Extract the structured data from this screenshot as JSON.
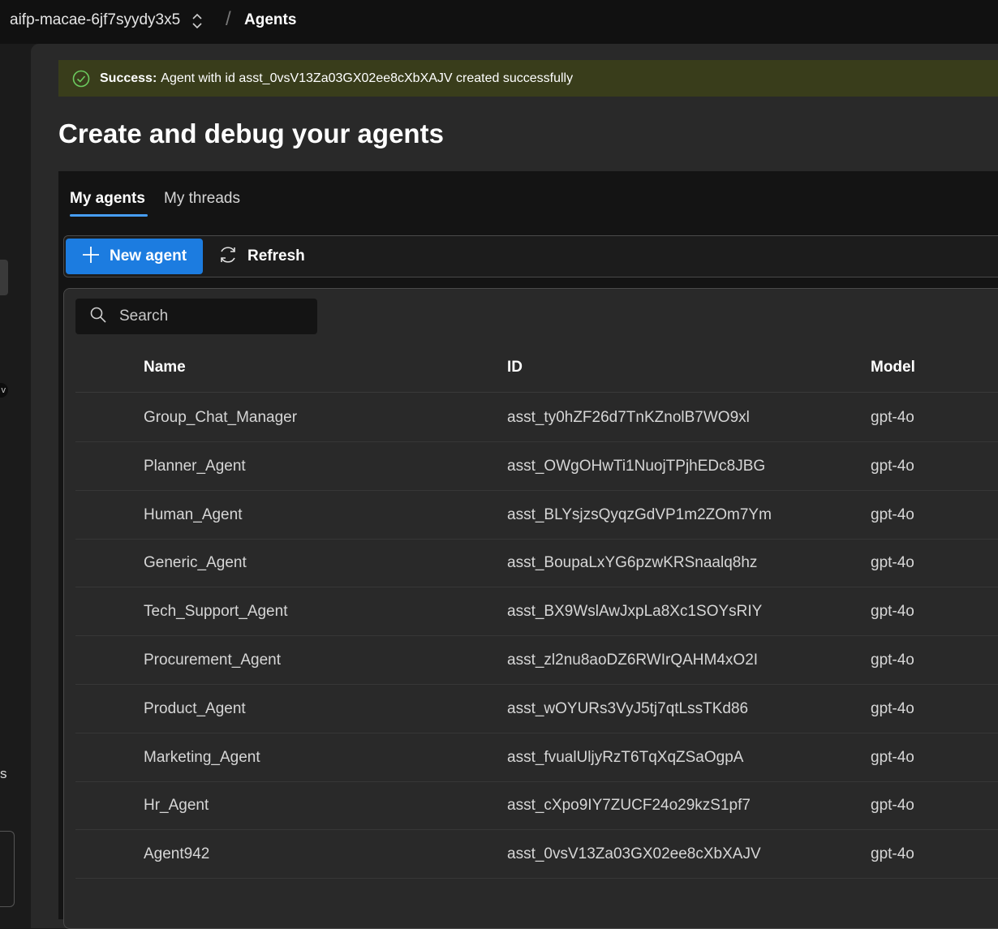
{
  "topbar": {
    "project_name": "aifp-macae-6jf7syydy3x5",
    "breadcrumb_separator": "/",
    "breadcrumb_current": "Agents"
  },
  "leftrail": {
    "badge_text": "v",
    "letter": "s"
  },
  "banner": {
    "status_label": "Success:",
    "message": "Agent with id asst_0vsV13Za03GX02ee8cXbXAJV created successfully",
    "color": "#393d1b",
    "icon": "check-circle-icon"
  },
  "page": {
    "title": "Create and debug your agents"
  },
  "tabs": [
    {
      "label": "My agents",
      "active": true
    },
    {
      "label": "My threads",
      "active": false
    }
  ],
  "toolbar": {
    "new_agent_label": "New agent",
    "refresh_label": "Refresh",
    "accent_color": "#1c7ce0"
  },
  "search": {
    "placeholder": "Search",
    "value": ""
  },
  "table": {
    "columns": [
      "Name",
      "ID",
      "Model"
    ],
    "rows": [
      {
        "name": "Group_Chat_Manager",
        "id": "asst_ty0hZF26d7TnKZnolB7WO9xl",
        "model": "gpt-4o"
      },
      {
        "name": "Planner_Agent",
        "id": "asst_OWgOHwTi1NuojTPjhEDc8JBG",
        "model": "gpt-4o"
      },
      {
        "name": "Human_Agent",
        "id": "asst_BLYsjzsQyqzGdVP1m2ZOm7Ym",
        "model": "gpt-4o"
      },
      {
        "name": "Generic_Agent",
        "id": "asst_BoupaLxYG6pzwKRSnaalq8hz",
        "model": "gpt-4o"
      },
      {
        "name": "Tech_Support_Agent",
        "id": "asst_BX9WslAwJxpLa8Xc1SOYsRIY",
        "model": "gpt-4o"
      },
      {
        "name": "Procurement_Agent",
        "id": "asst_zl2nu8aoDZ6RWIrQAHM4xO2I",
        "model": "gpt-4o"
      },
      {
        "name": "Product_Agent",
        "id": "asst_wOYURs3VyJ5tj7qtLssTKd86",
        "model": "gpt-4o"
      },
      {
        "name": "Marketing_Agent",
        "id": "asst_fvualUljyRzT6TqXqZSaOgpA",
        "model": "gpt-4o"
      },
      {
        "name": "Hr_Agent",
        "id": "asst_cXpo9IY7ZUCF24o29kzS1pf7",
        "model": "gpt-4o"
      },
      {
        "name": "Agent942",
        "id": "asst_0vsV13Za03GX02ee8cXbXAJV",
        "model": "gpt-4o"
      }
    ]
  }
}
